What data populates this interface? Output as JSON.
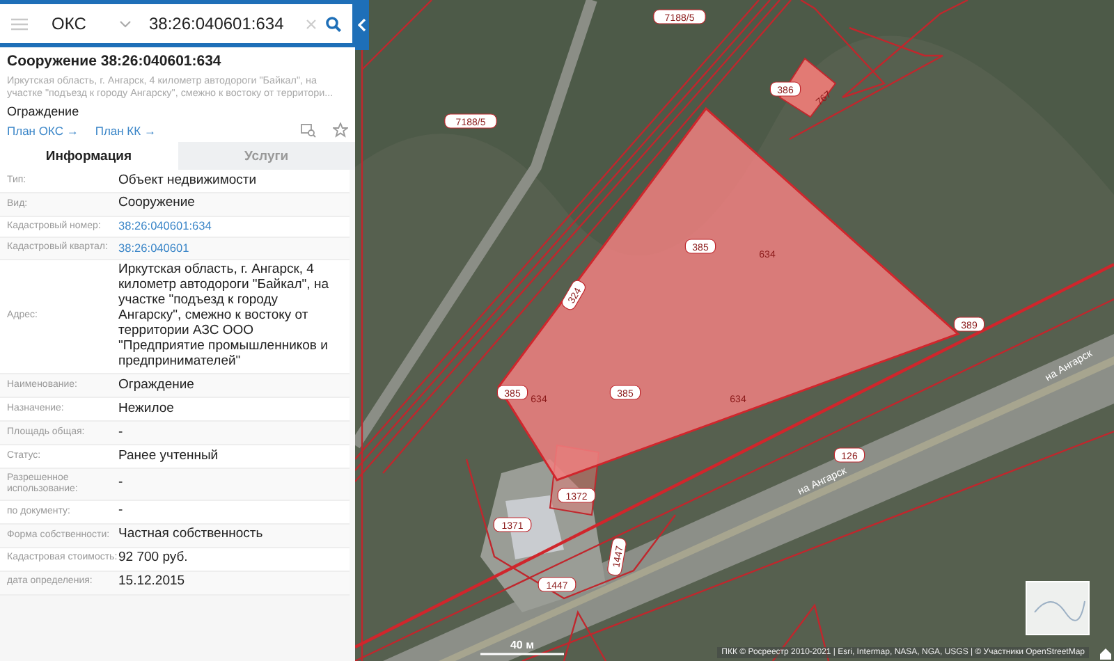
{
  "search": {
    "category": "ОКС",
    "query": "38:26:040601:634"
  },
  "object": {
    "title": "Сооружение 38:26:040601:634",
    "address_preview": "Иркутская область, г. Ангарск, 4 километр автодороги \"Байкал\", на участке \"подъезд к городу Ангарску\", смежно к востоку от территори...",
    "name": "Ограждение",
    "links": [
      "План ОКС →",
      "План КК →"
    ]
  },
  "tabs": [
    {
      "label": "Информация",
      "selected": true
    },
    {
      "label": "Услуги",
      "selected": false
    }
  ],
  "info_rows": [
    {
      "label": "Тип:",
      "value": "Объект недвижимости",
      "kind": "text"
    },
    {
      "label": "Вид:",
      "value": "Сооружение",
      "kind": "text"
    },
    {
      "label": "Кадастровый номер:",
      "value": "38:26:040601:634",
      "kind": "link"
    },
    {
      "label": "Кадастровый квартал:",
      "value": "38:26:040601",
      "kind": "link"
    },
    {
      "label": "Адрес:",
      "value": "Иркутская область, г. Ангарск, 4 километр автодороги \"Байкал\", на участке \"подъезд к городу Ангарску\", смежно к востоку от территории АЗС ООО \"Предприятие промышленников и предпринимателей\"",
      "kind": "text"
    },
    {
      "label": "Наименование:",
      "value": "Ограждение",
      "kind": "text"
    },
    {
      "label": "Назначение:",
      "value": "Нежилое",
      "kind": "text"
    },
    {
      "label": "Площадь общая:",
      "value": "-",
      "kind": "text"
    },
    {
      "label": "Статус:",
      "value": "Ранее учтенный",
      "kind": "text"
    },
    {
      "label": "Разрешенное использование:",
      "value": "-",
      "kind": "text"
    },
    {
      "label": "по документу:",
      "value": "-",
      "kind": "text"
    },
    {
      "label": "Форма собственности:",
      "value": "Частная собственность",
      "kind": "text"
    },
    {
      "label": "Кадастровая стоимость:",
      "value": "92 700 руб.",
      "kind": "text"
    },
    {
      "label": "дата определения:",
      "value": "15.12.2015",
      "kind": "text"
    }
  ],
  "map": {
    "labels": [
      {
        "text": "7188/5",
        "kind": "parcel"
      },
      {
        "text": "7188/5",
        "kind": "parcel"
      },
      {
        "text": "386",
        "kind": "parcel"
      },
      {
        "text": "767",
        "kind": "building"
      },
      {
        "text": "385",
        "kind": "parcel"
      },
      {
        "text": "634",
        "kind": "building"
      },
      {
        "text": "389",
        "kind": "parcel"
      },
      {
        "text": "385",
        "kind": "parcel"
      },
      {
        "text": "634",
        "kind": "building"
      },
      {
        "text": "385",
        "kind": "parcel"
      },
      {
        "text": "634",
        "kind": "building"
      },
      {
        "text": "126",
        "kind": "parcel"
      },
      {
        "text": "на Ангарск",
        "kind": "road"
      },
      {
        "text": "на Ангарск",
        "kind": "road"
      },
      {
        "text": "1372",
        "kind": "parcel"
      },
      {
        "text": "1371",
        "kind": "parcel"
      },
      {
        "text": "1447",
        "kind": "parcel"
      },
      {
        "text": "1447",
        "kind": "parcel"
      },
      {
        "text": "324",
        "kind": "parcel"
      }
    ],
    "scale": "40 м",
    "attribution": "ПКК © Росреестр 2010-2021 | Esri, Intermap, NASA, NGA, USGS | © Участники OpenStreetMap"
  }
}
